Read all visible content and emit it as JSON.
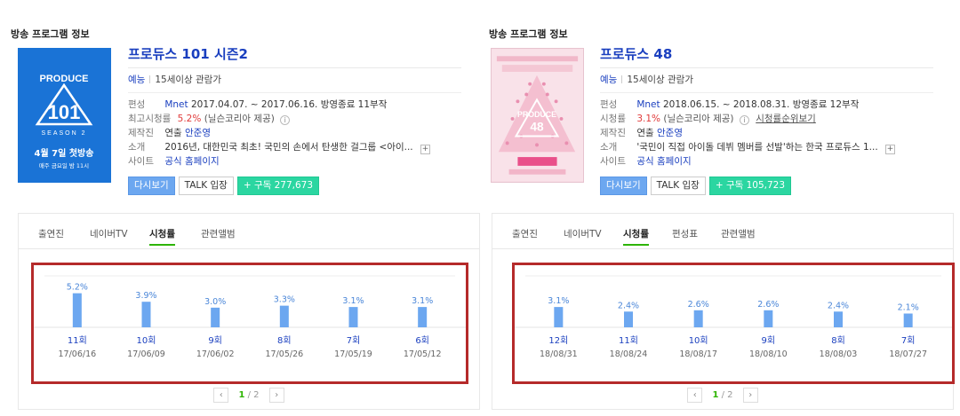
{
  "panels": [
    {
      "section_title": "방송 프로그램 정보",
      "poster": {
        "brand": "PRODUCE",
        "number": "101",
        "season": "SEASON 2",
        "line1": "4월 7일 첫방송",
        "line2": "매주 금요일 밤 11시"
      },
      "title": "프로듀스 101 시즌2",
      "genre": "예능",
      "rating": "15세이상 관람가",
      "rows": {
        "schedule_label": "편성",
        "schedule_channel": "Mnet",
        "schedule_value": "2017.04.07. ~ 2017.06.16. 방영종료 11부작",
        "peak_label": "최고시청률",
        "peak_value": "5.2%",
        "peak_source": "(닐슨코리아 제공)",
        "peak_link": "",
        "staff_label": "제작진",
        "staff_role": "연출",
        "staff_name": "안준영",
        "intro_label": "소개",
        "intro_value": "2016년, 대한민국 최초! 국민의 손에서 탄생한 걸그룹 <아이...",
        "site_label": "사이트",
        "site_value": "공식 홈페이지"
      },
      "buttons": {
        "replay": "다시보기",
        "talk": "TALK 입장",
        "subscribe": "+ 구독 277,673"
      },
      "tabs": [
        "출연진",
        "네이버TV",
        "시청률",
        "관련앨범"
      ],
      "active_tab": 2,
      "pager": {
        "current": "1",
        "total": "/ 2"
      },
      "chart_data": {
        "type": "bar",
        "categories": [
          "11회\n17/06/16",
          "10회\n17/06/09",
          "9회\n17/06/02",
          "8회\n17/05/26",
          "7회\n17/05/19",
          "6회\n17/05/12"
        ],
        "episodes": [
          "11회",
          "10회",
          "9회",
          "8회",
          "7회",
          "6회"
        ],
        "dates": [
          "17/06/16",
          "17/06/09",
          "17/06/02",
          "17/05/26",
          "17/05/19",
          "17/05/12"
        ],
        "values": [
          5.2,
          3.9,
          3.0,
          3.3,
          3.1,
          3.1
        ],
        "labels": [
          "5.2%",
          "3.9%",
          "3.0%",
          "3.3%",
          "3.1%",
          "3.1%"
        ],
        "ylim": [
          0,
          6.5
        ],
        "title": "",
        "xlabel": "",
        "ylabel": ""
      }
    },
    {
      "section_title": "방송 프로그램 정보",
      "poster": {
        "brand": "PRODUCE",
        "number": "48",
        "season": "",
        "line1": "",
        "line2": ""
      },
      "title": "프로듀스 48",
      "genre": "예능",
      "rating": "15세이상 관람가",
      "rows": {
        "schedule_label": "편성",
        "schedule_channel": "Mnet",
        "schedule_value": "2018.06.15. ~ 2018.08.31. 방영종료 12부작",
        "peak_label": "시청률",
        "peak_value": "3.1%",
        "peak_source": "(닐슨코리아 제공)",
        "peak_link": "시청률순위보기",
        "staff_label": "제작진",
        "staff_role": "연출",
        "staff_name": "안준영",
        "intro_label": "소개",
        "intro_value": "'국민이 직접 아이돌 데뷔 멤버를 선발'하는 한국 프로듀스 1...",
        "site_label": "사이트",
        "site_value": "공식 홈페이지"
      },
      "buttons": {
        "replay": "다시보기",
        "talk": "TALK 입장",
        "subscribe": "+ 구독 105,723"
      },
      "tabs": [
        "출연진",
        "네이버TV",
        "시청률",
        "편성표",
        "관련앨범"
      ],
      "active_tab": 2,
      "pager": {
        "current": "1",
        "total": "/ 2"
      },
      "chart_data": {
        "type": "bar",
        "categories": [
          "12회\n18/08/31",
          "11회\n18/08/24",
          "10회\n18/08/17",
          "9회\n18/08/10",
          "8회\n18/08/03",
          "7회\n18/07/27"
        ],
        "episodes": [
          "12회",
          "11회",
          "10회",
          "9회",
          "8회",
          "7회"
        ],
        "dates": [
          "18/08/31",
          "18/08/24",
          "18/08/17",
          "18/08/10",
          "18/08/03",
          "18/07/27"
        ],
        "values": [
          3.1,
          2.4,
          2.6,
          2.6,
          2.4,
          2.1
        ],
        "labels": [
          "3.1%",
          "2.4%",
          "2.6%",
          "2.6%",
          "2.4%",
          "2.1%"
        ],
        "ylim": [
          0,
          6.5
        ],
        "title": "",
        "xlabel": "",
        "ylabel": ""
      }
    }
  ],
  "colors": {
    "title_blue": "#1a3fbf",
    "bar_blue": "#6ca7f0",
    "highlight_red": "#b52a2a",
    "active_tab_green": "#2db400",
    "subscribe_green": "#2bd6a1",
    "peak_red": "#e03a3a"
  }
}
